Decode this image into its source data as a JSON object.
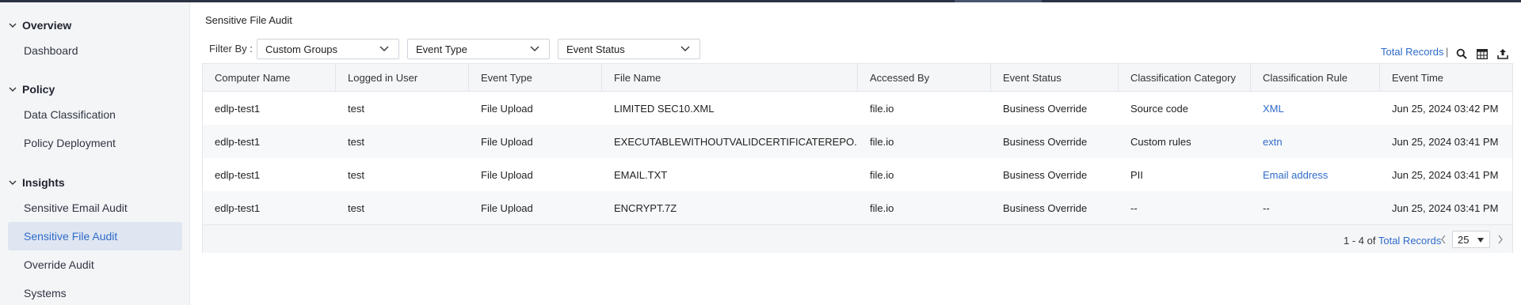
{
  "sidebar": {
    "sections": [
      {
        "title": "Overview",
        "items": [
          "Dashboard"
        ]
      },
      {
        "title": "Policy",
        "items": [
          "Data Classification",
          "Policy Deployment"
        ]
      },
      {
        "title": "Insights",
        "items": [
          "Sensitive Email Audit",
          "Sensitive File Audit",
          "Override Audit",
          "Systems"
        ]
      }
    ],
    "active_item": "Sensitive File Audit"
  },
  "page": {
    "title": "Sensitive File Audit",
    "filter_label": "Filter By :",
    "filters": [
      "Custom Groups",
      "Event Type",
      "Event Status"
    ],
    "total_records_link": "Total Records",
    "separator": "|"
  },
  "toolbar_icons": [
    "search-icon",
    "table-columns-icon",
    "export-icon"
  ],
  "table": {
    "columns": [
      "Computer Name",
      "Logged in User",
      "Event Type",
      "File Name",
      "Accessed By",
      "Event Status",
      "Classification Category",
      "Classification Rule",
      "Event Time"
    ],
    "rows": [
      [
        "edlp-test1",
        "test",
        "File Upload",
        "LIMITED SEC10.XML",
        "file.io",
        "Business Override",
        "Source code",
        "XML",
        "Jun 25, 2024 03:42 PM"
      ],
      [
        "edlp-test1",
        "test",
        "File Upload",
        "EXECUTABLEWITHOUTVALIDCERTIFICATEREPO...",
        "file.io",
        "Business Override",
        "Custom rules",
        "extn",
        "Jun 25, 2024 03:41 PM"
      ],
      [
        "edlp-test1",
        "test",
        "File Upload",
        "EMAIL.TXT",
        "file.io",
        "Business Override",
        "PII",
        "Email address",
        "Jun 25, 2024 03:41 PM"
      ],
      [
        "edlp-test1",
        "test",
        "File Upload",
        "ENCRYPT.7Z",
        "file.io",
        "Business Override",
        "--",
        "--",
        "Jun 25, 2024 03:41 PM"
      ]
    ]
  },
  "pagination": {
    "range_text": "1 - 4 of",
    "total_link": "Total Records",
    "page_size": "25"
  },
  "colors": {
    "accent": "#2f6bc9",
    "sidebar_bg": "#f4f5f7",
    "active_bg": "#dfe6f1"
  }
}
